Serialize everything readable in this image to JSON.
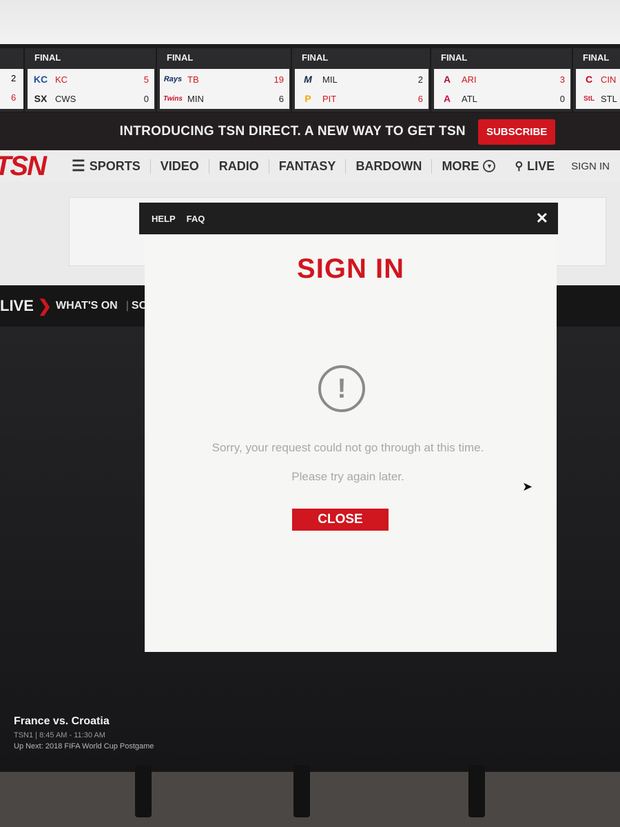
{
  "scoreboard": {
    "partial_scores": [
      "2",
      "6"
    ],
    "games": [
      {
        "status": "FINAL",
        "teams": [
          {
            "abbr": "KC",
            "score": "5",
            "logo": "KC"
          },
          {
            "abbr": "CWS",
            "score": "0",
            "logo": "SX"
          }
        ]
      },
      {
        "status": "FINAL",
        "teams": [
          {
            "abbr": "TB",
            "score": "19",
            "logo": "Rays"
          },
          {
            "abbr": "MIN",
            "score": "6",
            "logo": "Twins"
          }
        ]
      },
      {
        "status": "FINAL",
        "teams": [
          {
            "abbr": "MIL",
            "score": "2",
            "logo": "M"
          },
          {
            "abbr": "PIT",
            "score": "6",
            "logo": "P"
          }
        ]
      },
      {
        "status": "FINAL",
        "teams": [
          {
            "abbr": "ARI",
            "score": "3",
            "logo": "A"
          },
          {
            "abbr": "ATL",
            "score": "0",
            "logo": "A"
          }
        ]
      },
      {
        "status": "FINAL",
        "teams": [
          {
            "abbr": "CIN",
            "score": "",
            "logo": "C"
          },
          {
            "abbr": "STL",
            "score": "",
            "logo": "StL"
          }
        ]
      }
    ]
  },
  "promo": {
    "text": "INTRODUCING TSN DIRECT. A NEW WAY TO GET TSN",
    "subscribe_label": "SUBSCRIBE"
  },
  "nav": {
    "brand": "TSN",
    "items": [
      "SPORTS",
      "VIDEO",
      "RADIO",
      "FANTASY",
      "BARDOWN",
      "MORE",
      "LIVE"
    ],
    "sign_in": "SIGN IN"
  },
  "live_bar": {
    "label": "LIVE",
    "whats_on": "WHAT'S ON",
    "sch": "SCH"
  },
  "now_playing": {
    "title": "France vs. Croatia",
    "time": "TSN1 | 8:45 AM - 11:30 AM",
    "up_next": "Up Next: 2018 FIFA World Cup Postgame"
  },
  "modal": {
    "help": "HELP",
    "faq": "FAQ",
    "title": "SIGN IN",
    "message_line1": "Sorry, your request could not go through at this time.",
    "message_line2": "Please try again later.",
    "close_label": "CLOSE"
  },
  "colors": {
    "accent": "#d0161f",
    "header": "#231f20"
  }
}
